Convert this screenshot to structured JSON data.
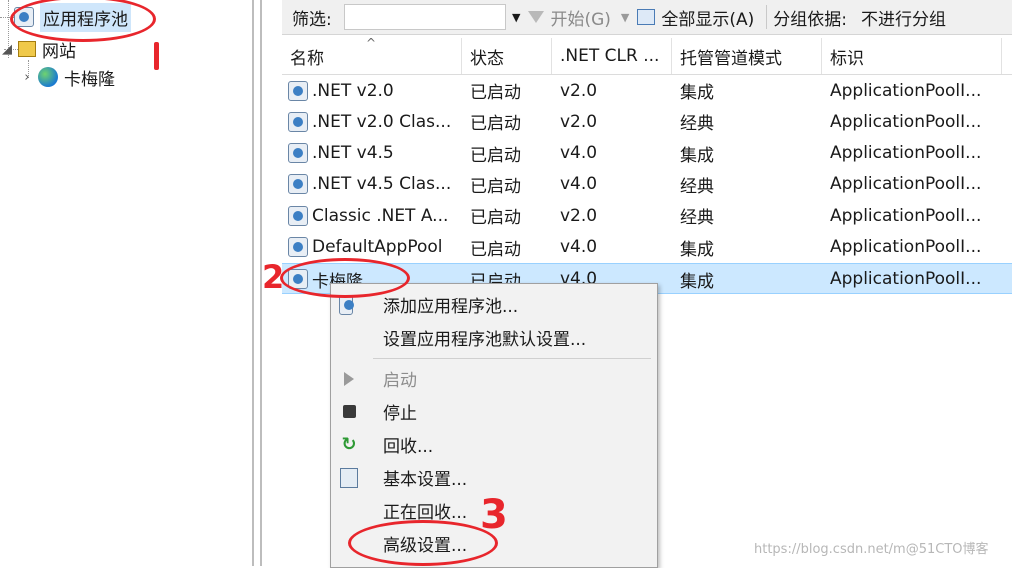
{
  "tree": {
    "app_pools": "应用程序池",
    "sites": "网站",
    "site_items": [
      "卡梅隆"
    ]
  },
  "toolbar": {
    "filter_label": "筛选:",
    "start_label": "开始(G)",
    "show_all_label": "全部显示(A)",
    "group_by_label": "分组依据:",
    "group_by_value": "不进行分组"
  },
  "grid": {
    "columns": [
      "名称",
      "状态",
      ".NET CLR ...",
      "托管管道模式",
      "标识"
    ],
    "rows": [
      {
        "name": ".NET v2.0",
        "status": "已启动",
        "clr": "v2.0",
        "pipeline": "集成",
        "identity": "ApplicationPoolI..."
      },
      {
        "name": ".NET v2.0 Clas...",
        "status": "已启动",
        "clr": "v2.0",
        "pipeline": "经典",
        "identity": "ApplicationPoolI..."
      },
      {
        "name": ".NET v4.5",
        "status": "已启动",
        "clr": "v4.0",
        "pipeline": "集成",
        "identity": "ApplicationPoolI..."
      },
      {
        "name": ".NET v4.5 Clas...",
        "status": "已启动",
        "clr": "v4.0",
        "pipeline": "经典",
        "identity": "ApplicationPoolI..."
      },
      {
        "name": "Classic .NET A...",
        "status": "已启动",
        "clr": "v2.0",
        "pipeline": "经典",
        "identity": "ApplicationPoolI..."
      },
      {
        "name": "DefaultAppPool",
        "status": "已启动",
        "clr": "v4.0",
        "pipeline": "集成",
        "identity": "ApplicationPoolI..."
      },
      {
        "name": "卡梅隆",
        "status": "已启动",
        "clr": "v4.0",
        "pipeline": "集成",
        "identity": "ApplicationPoolI..."
      }
    ]
  },
  "context_menu": {
    "add_pool": "添加应用程序池...",
    "set_defaults": "设置应用程序池默认设置...",
    "start": "启动",
    "stop": "停止",
    "recycle": "回收...",
    "basic_settings": "基本设置...",
    "recycling": "正在回收...",
    "advanced_settings": "高级设置..."
  },
  "annotations": {
    "step2": "2",
    "step3": "3"
  },
  "watermark": "https://blog.csdn.net/m@51CTO博客",
  "colors": {
    "selection": "#cce8ff",
    "annotation_red": "#e8262c"
  }
}
